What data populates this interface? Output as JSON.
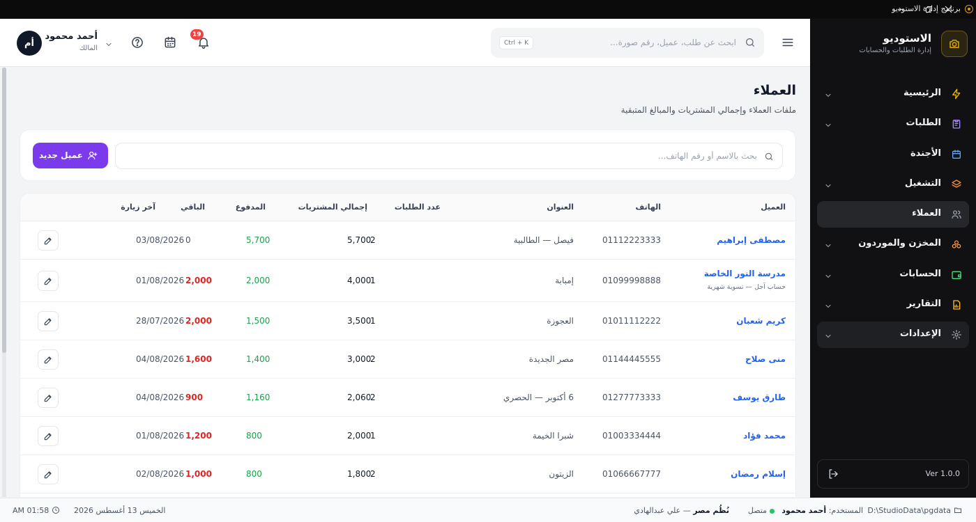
{
  "window": {
    "title": "برنامج إدارة الاستوديو"
  },
  "brand": {
    "name": "الاستوديو",
    "subtitle": "إدارة الطلبات والحسابات"
  },
  "sidebar": {
    "items": [
      {
        "label": "الرئيسية",
        "icon": "bolt-icon",
        "chevron": true
      },
      {
        "label": "الطلبات",
        "icon": "clipboard-icon",
        "chevron": true
      },
      {
        "label": "الأجندة",
        "icon": "calendar-icon",
        "chevron": false
      },
      {
        "label": "التشغيل",
        "icon": "layers-icon",
        "chevron": true
      },
      {
        "label": "العملاء",
        "icon": "users-icon",
        "chevron": false,
        "active": true
      },
      {
        "label": "المخزن والموردون",
        "icon": "boxes-icon",
        "chevron": true
      },
      {
        "label": "الحسابات",
        "icon": "wallet-icon",
        "chevron": true
      },
      {
        "label": "التقارير",
        "icon": "report-icon",
        "chevron": true
      },
      {
        "label": "الإعدادات",
        "icon": "gear-icon",
        "chevron": true
      }
    ],
    "version": "Ver 1.0.0"
  },
  "header": {
    "search_placeholder": "ابحث عن طلب، عميل، رقم صورة...",
    "shortcut": "Ctrl + K",
    "notifications_count": "19",
    "user": {
      "name": "أحمد محمود",
      "role": "المالك",
      "initials": "أم"
    }
  },
  "page": {
    "title": "العملاء",
    "subtitle": "ملفات العملاء وإجمالي المشتريات والمبالغ المتبقية",
    "search_placeholder": "بحث بالاسم أو رقم الهاتف...",
    "new_button": "عميل جديد"
  },
  "table": {
    "columns": [
      "العميل",
      "الهاتف",
      "العنوان",
      "عدد الطلبات",
      "إجمالي المشتريات",
      "المدفوع",
      "الباقي",
      "آخر زيارة"
    ],
    "rows": [
      {
        "name": "مصطفى إبراهيم",
        "note": "",
        "phone": "01112223333",
        "address": "فيصل — الطالبية",
        "orders": "2",
        "total": "5,700",
        "paid": "5,700",
        "due": "0",
        "last": "03/08/2026"
      },
      {
        "name": "مدرسة النور الخاصة",
        "note": "حساب آجل — تسوية شهرية",
        "phone": "01099998888",
        "address": "إمبابة",
        "orders": "1",
        "total": "4,000",
        "paid": "2,000",
        "due": "2,000",
        "last": "01/08/2026"
      },
      {
        "name": "كريم شعبان",
        "note": "",
        "phone": "01011112222",
        "address": "العجوزة",
        "orders": "1",
        "total": "3,500",
        "paid": "1,500",
        "due": "2,000",
        "last": "28/07/2026"
      },
      {
        "name": "منى صلاح",
        "note": "",
        "phone": "01144445555",
        "address": "مصر الجديدة",
        "orders": "2",
        "total": "3,000",
        "paid": "1,400",
        "due": "1,600",
        "last": "04/08/2026"
      },
      {
        "name": "طارق يوسف",
        "note": "",
        "phone": "01277773333",
        "address": "6 أكتوبر — الحصري",
        "orders": "2",
        "total": "2,060",
        "paid": "1,160",
        "due": "900",
        "last": "04/08/2026"
      },
      {
        "name": "محمد فؤاد",
        "note": "",
        "phone": "01003334444",
        "address": "شبرا الخيمة",
        "orders": "1",
        "total": "2,000",
        "paid": "800",
        "due": "1,200",
        "last": "01/08/2026"
      },
      {
        "name": "إسلام رمضان",
        "note": "",
        "phone": "01066667777",
        "address": "الزيتون",
        "orders": "2",
        "total": "1,800",
        "paid": "800",
        "due": "1,000",
        "last": "02/08/2026"
      }
    ]
  },
  "statusbar": {
    "path": "D:\\StudioData\\pgdata",
    "user_label": "المستخدم:",
    "user_name": "أحمد محمود",
    "online": "متصل",
    "agent": "نُظُم مصر",
    "agent_person": "— علي عبدالهادي",
    "date": "الخميس 13 أغسطس 2026",
    "time": "01:58 AM"
  },
  "colors": {
    "accent": "#7c3aed",
    "sidebar_bg": "#111113",
    "link": "#2563eb",
    "paid": "#16a34a",
    "due": "#dc2626",
    "brand_gold": "#d4a017"
  }
}
